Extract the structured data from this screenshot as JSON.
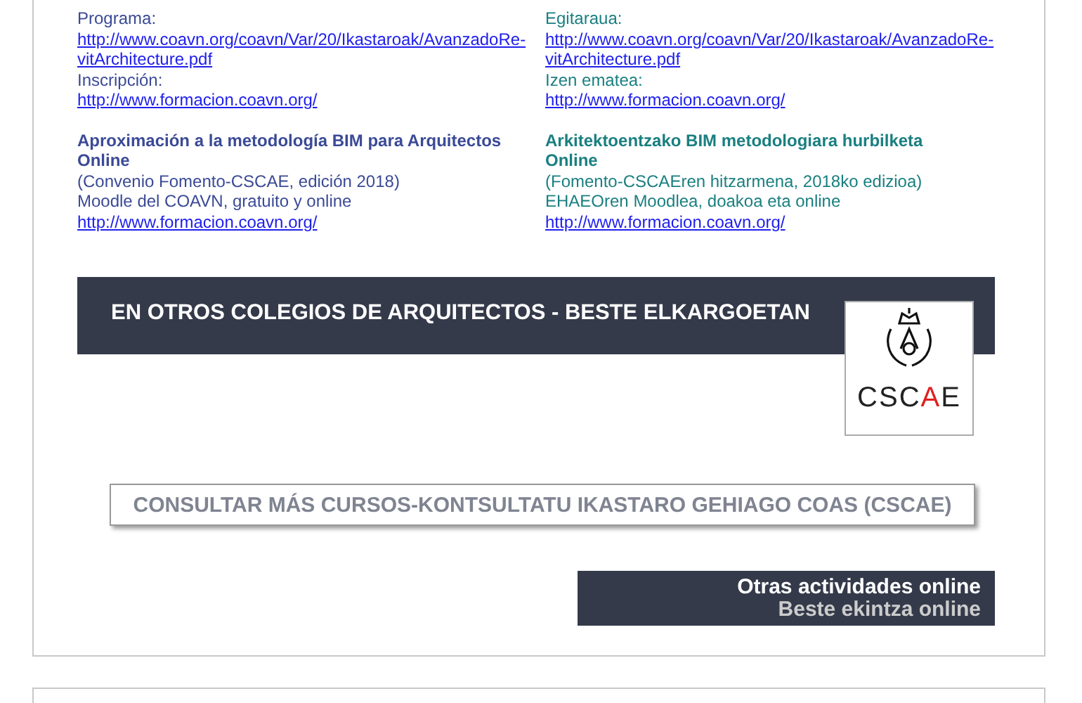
{
  "columns": [
    {
      "color": "#3b4a96",
      "blocks": [
        {
          "lines": [
            {
              "kind": "text",
              "text": "Programa:"
            },
            {
              "kind": "link",
              "text": "http://www.coavn.org/coavn/Var/20/Ikastaroak/AvanzadoRe-vitArchitecture.pdf"
            },
            {
              "kind": "text",
              "text": "Inscripción:"
            },
            {
              "kind": "link",
              "text": "http://www.formacion.coavn.org/"
            }
          ]
        },
        {
          "lines": [
            {
              "kind": "title",
              "text": "Aproximación a la metodología BIM para Arquitectos Online"
            },
            {
              "kind": "text",
              "text": "(Convenio Fomento-CSCAE, edición 2018)"
            },
            {
              "kind": "text",
              "text": "Moodle del COAVN, gratuito y online"
            },
            {
              "kind": "link",
              "text": "http://www.formacion.coavn.org/"
            }
          ]
        }
      ]
    },
    {
      "color": "#1a7f80",
      "blocks": [
        {
          "lines": [
            {
              "kind": "text",
              "text": "Egitaraua:"
            },
            {
              "kind": "link",
              "text": "http://www.coavn.org/coavn/Var/20/Ikastaroak/AvanzadoRe-vitArchitecture.pdf"
            },
            {
              "kind": "text",
              "text": "Izen ematea:"
            },
            {
              "kind": "link",
              "text": "http://www.formacion.coavn.org/"
            }
          ]
        },
        {
          "lines": [
            {
              "kind": "title",
              "text": "Arkitektoentzako BIM metodologiara hurbilketa"
            },
            {
              "kind": "title",
              "text": "Online"
            },
            {
              "kind": "text",
              "text": "(Fomento-CSCAEren hitzarmena, 2018ko edizioa)"
            },
            {
              "kind": "text",
              "text": "EHAEOren Moodlea, doakoa eta online"
            },
            {
              "kind": "link",
              "text": "http://www.formacion.coavn.org/"
            }
          ]
        }
      ]
    }
  ],
  "banner": {
    "title": "EN OTROS COLEGIOS DE ARQUITECTOS - BESTE ELKARGOETAN",
    "logo": "CSCAE"
  },
  "consult_button": "CONSULTAR MÁS CURSOS-KONTSULTATU IKASTARO GEHIAGO COAS (CSCAE)",
  "online_button": [
    "Otras actividades online",
    "Beste ekintza online"
  ]
}
